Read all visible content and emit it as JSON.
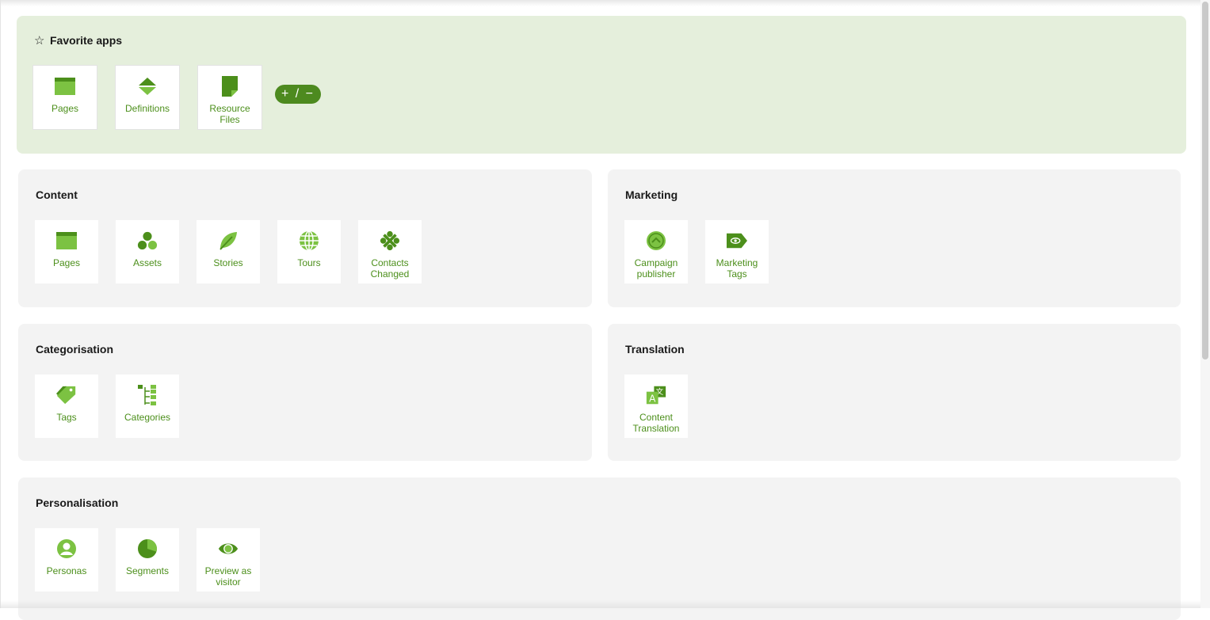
{
  "favorites": {
    "title": "Favorite apps",
    "toggle_label": "+ / −",
    "tiles": [
      {
        "label": "Pages",
        "icon": "pages-icon"
      },
      {
        "label": "Definitions",
        "icon": "definitions-icon"
      },
      {
        "label": "Resource Files",
        "icon": "resource-files-icon"
      }
    ]
  },
  "content": {
    "title": "Content",
    "tiles": [
      {
        "label": "Pages",
        "icon": "pages-icon"
      },
      {
        "label": "Assets",
        "icon": "assets-icon"
      },
      {
        "label": "Stories",
        "icon": "stories-icon"
      },
      {
        "label": "Tours",
        "icon": "tours-icon"
      },
      {
        "label": "Contacts Changed",
        "icon": "contacts-changed-icon"
      }
    ]
  },
  "marketing": {
    "title": "Marketing",
    "tiles": [
      {
        "label": "Campaign publisher",
        "icon": "campaign-publisher-icon"
      },
      {
        "label": "Marketing Tags",
        "icon": "marketing-tags-icon"
      }
    ]
  },
  "categorisation": {
    "title": "Categorisation",
    "tiles": [
      {
        "label": "Tags",
        "icon": "tags-icon"
      },
      {
        "label": "Categories",
        "icon": "categories-icon"
      }
    ]
  },
  "translation": {
    "title": "Translation",
    "tiles": [
      {
        "label": "Content Translation",
        "icon": "content-translation-icon"
      }
    ]
  },
  "personalisation": {
    "title": "Personalisation",
    "tiles": [
      {
        "label": "Personas",
        "icon": "personas-icon"
      },
      {
        "label": "Segments",
        "icon": "segments-icon"
      },
      {
        "label": "Preview as visitor",
        "icon": "preview-as-visitor-icon"
      }
    ]
  },
  "colors": {
    "accent": "#4c8f1b",
    "accent_light": "#7cc242",
    "favorites_bg": "#e5efdc",
    "panel_bg": "#f3f3f3"
  }
}
